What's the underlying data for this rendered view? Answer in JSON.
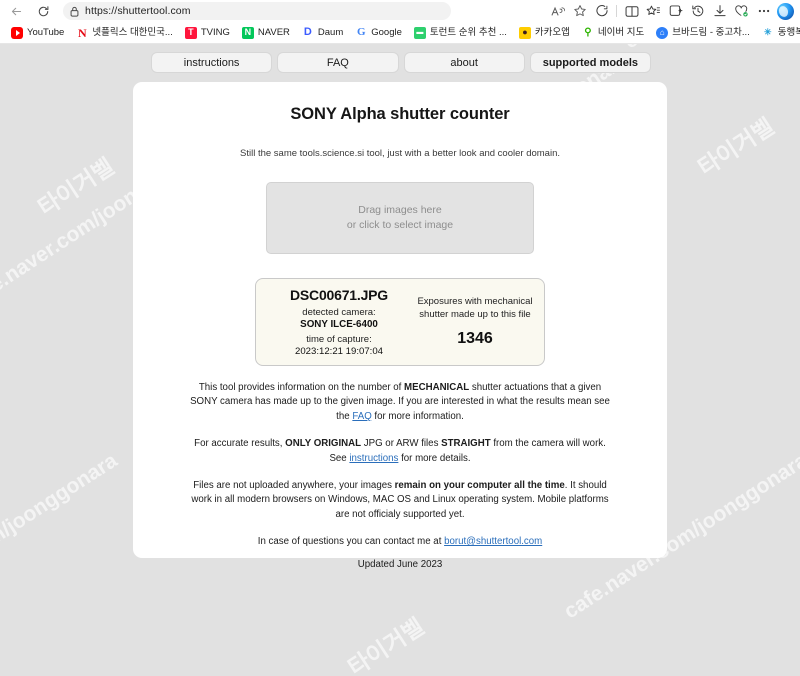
{
  "browser": {
    "url": "https://shuttertool.com",
    "back_title": "Back",
    "refresh_title": "Refresh",
    "lock_icon": "lock-icon",
    "right_icons": [
      {
        "name": "read-aloud-icon",
        "glyph": "A"
      },
      {
        "name": "favorite-star-icon",
        "glyph": "star"
      },
      {
        "name": "copilot-chat-icon",
        "glyph": "chat"
      },
      {
        "name": "split-screen-icon",
        "glyph": "split"
      },
      {
        "name": "favorites-icon",
        "glyph": "fav"
      },
      {
        "name": "collections-icon",
        "glyph": "collections"
      },
      {
        "name": "history-icon",
        "glyph": "history"
      },
      {
        "name": "downloads-icon",
        "glyph": "download"
      },
      {
        "name": "browser-essentials-icon",
        "glyph": "heart"
      },
      {
        "name": "settings-more-icon",
        "glyph": "…"
      }
    ],
    "bookmarks": [
      {
        "label": "YouTube",
        "icon": "youtube-favicon",
        "mark": ""
      },
      {
        "label": "넷플릭스 대한민국...",
        "icon": "netflix-favicon",
        "mark": "N"
      },
      {
        "label": "TVING",
        "icon": "tving-favicon",
        "mark": "T"
      },
      {
        "label": "NAVER",
        "icon": "naver-favicon",
        "mark": "N"
      },
      {
        "label": "Daum",
        "icon": "daum-favicon",
        "mark": "D"
      },
      {
        "label": "Google",
        "icon": "google-favicon",
        "mark": "G"
      },
      {
        "label": "토런트 순위 추천 ...",
        "icon": "torrent-favicon",
        "mark": "▬"
      },
      {
        "label": "카카오앱",
        "icon": "kakao-favicon",
        "mark": "●"
      },
      {
        "label": "네이버 지도",
        "icon": "naver-map-favicon",
        "mark": "⚲"
      },
      {
        "label": "브바드림 - 중고차...",
        "icon": "bbadream-favicon",
        "mark": "⌂"
      },
      {
        "label": "동행복권",
        "icon": "lotto-favicon",
        "mark": "✳"
      }
    ],
    "overflow_label": "›"
  },
  "nav_tabs": [
    {
      "label": "instructions"
    },
    {
      "label": "FAQ"
    },
    {
      "label": "about"
    },
    {
      "label": "supported models"
    }
  ],
  "main": {
    "title": "SONY Alpha shutter counter",
    "subtitle": "Still the same tools.science.si tool, just with a better look and cooler domain.",
    "dropzone": {
      "line1": "Drag images here",
      "line2": "or click to select image"
    },
    "result": {
      "file_name": "DSC00671.JPG",
      "camera_label": "detected camera:",
      "camera_value": "SONY ILCE-6400",
      "capture_label": "time of capture:",
      "capture_value": "2023:12:21 19:07:04",
      "exposures_label": "Exposures with mechanical shutter made up to this file",
      "shutter_count": "1346"
    },
    "paragraphs": {
      "p1_a": "This tool provides information on the number of ",
      "p1_b": "MECHANICAL",
      "p1_c": " shutter actuations that a given SONY camera has made up to the given image. If you are interested in what the results mean see the ",
      "p1_link": "FAQ",
      "p1_d": " for more information.",
      "p2_a": "For accurate results, ",
      "p2_b": "ONLY ORIGINAL",
      "p2_c": " JPG or ARW files ",
      "p2_d": "STRAIGHT",
      "p2_e": " from the camera will work. See ",
      "p2_link": "instructions",
      "p2_f": " for more details.",
      "p3_a": "Files are not uploaded anywhere, your images ",
      "p3_b": "remain on your computer all the time",
      "p3_c": ". It should work in all modern browsers on Windows, MAC OS and Linux operating system. Mobile platforms are not officialy supported yet.",
      "p4_a": "In case of questions you can contact me at ",
      "p4_link": "borut@shuttertool.com",
      "updated": "Updated June 2023"
    }
  },
  "watermarks": {
    "site": "cafe.naver.com/joonggonara",
    "shop": "타이거벨"
  }
}
